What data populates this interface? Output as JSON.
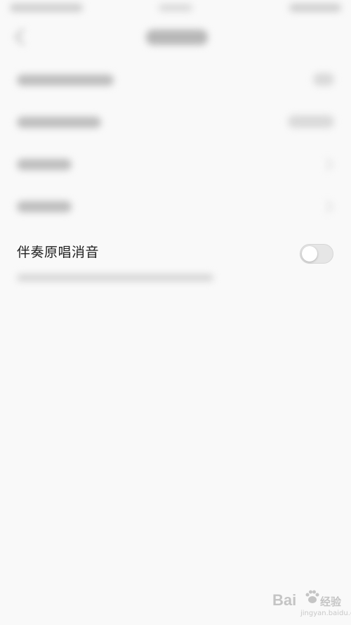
{
  "settings": {
    "karaoke_vocal_removal": {
      "label": "伴奏原唱消音",
      "enabled": false
    }
  },
  "watermark": {
    "brand": "Bai",
    "brand_sub": "经验",
    "url": "jingyan.baidu.com"
  },
  "colors": {
    "background": "#f9f9f9",
    "toggle_off": "#e6e6e6",
    "label": "#1f1f1f"
  }
}
